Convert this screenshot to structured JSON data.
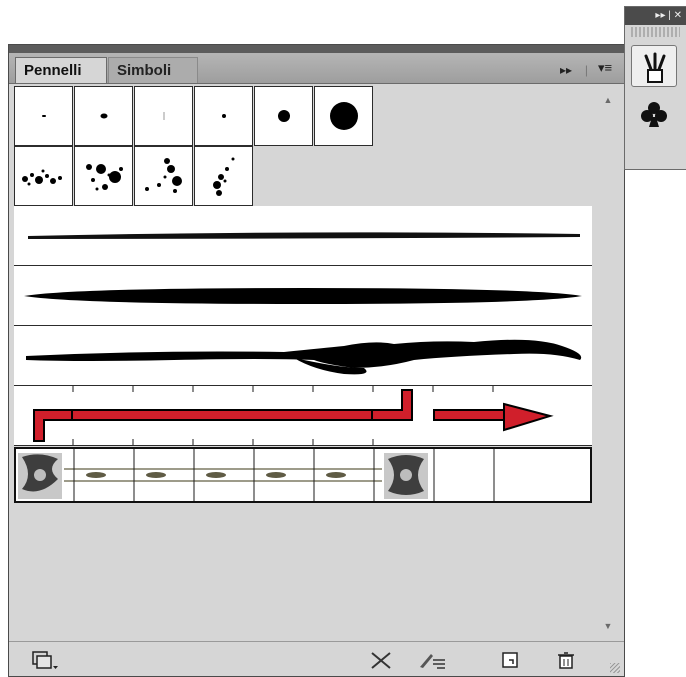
{
  "tabs": {
    "brushes": "Pennelli",
    "symbols": "Simboli"
  },
  "panel_controls": {
    "collapse_label": "▸▸",
    "menu_label": "▾≡"
  },
  "dock": {
    "header_label": "▸▸ | ✕",
    "brushes_icon": "brush-icon",
    "symbols_icon": "club-icon"
  },
  "brush_library": {
    "calligraphic_brushes": 6,
    "scatter_brushes": 4,
    "art_brushes": 3,
    "pattern_brushes": 2,
    "selected": "border-pattern-brush"
  },
  "scrollbar": {
    "up_arrow": "▲",
    "down_arrow": "▼"
  },
  "bottom_toolbar": {
    "icons": [
      "brush-libraries-menu-icon",
      "remove-brush-stroke-icon",
      "brush-options-icon",
      "new-brush-icon",
      "delete-brush-icon"
    ]
  },
  "colors": {
    "panel_bg": "#d6d6d6",
    "arrow_red": "#d01f2b",
    "dark": "#111111"
  }
}
